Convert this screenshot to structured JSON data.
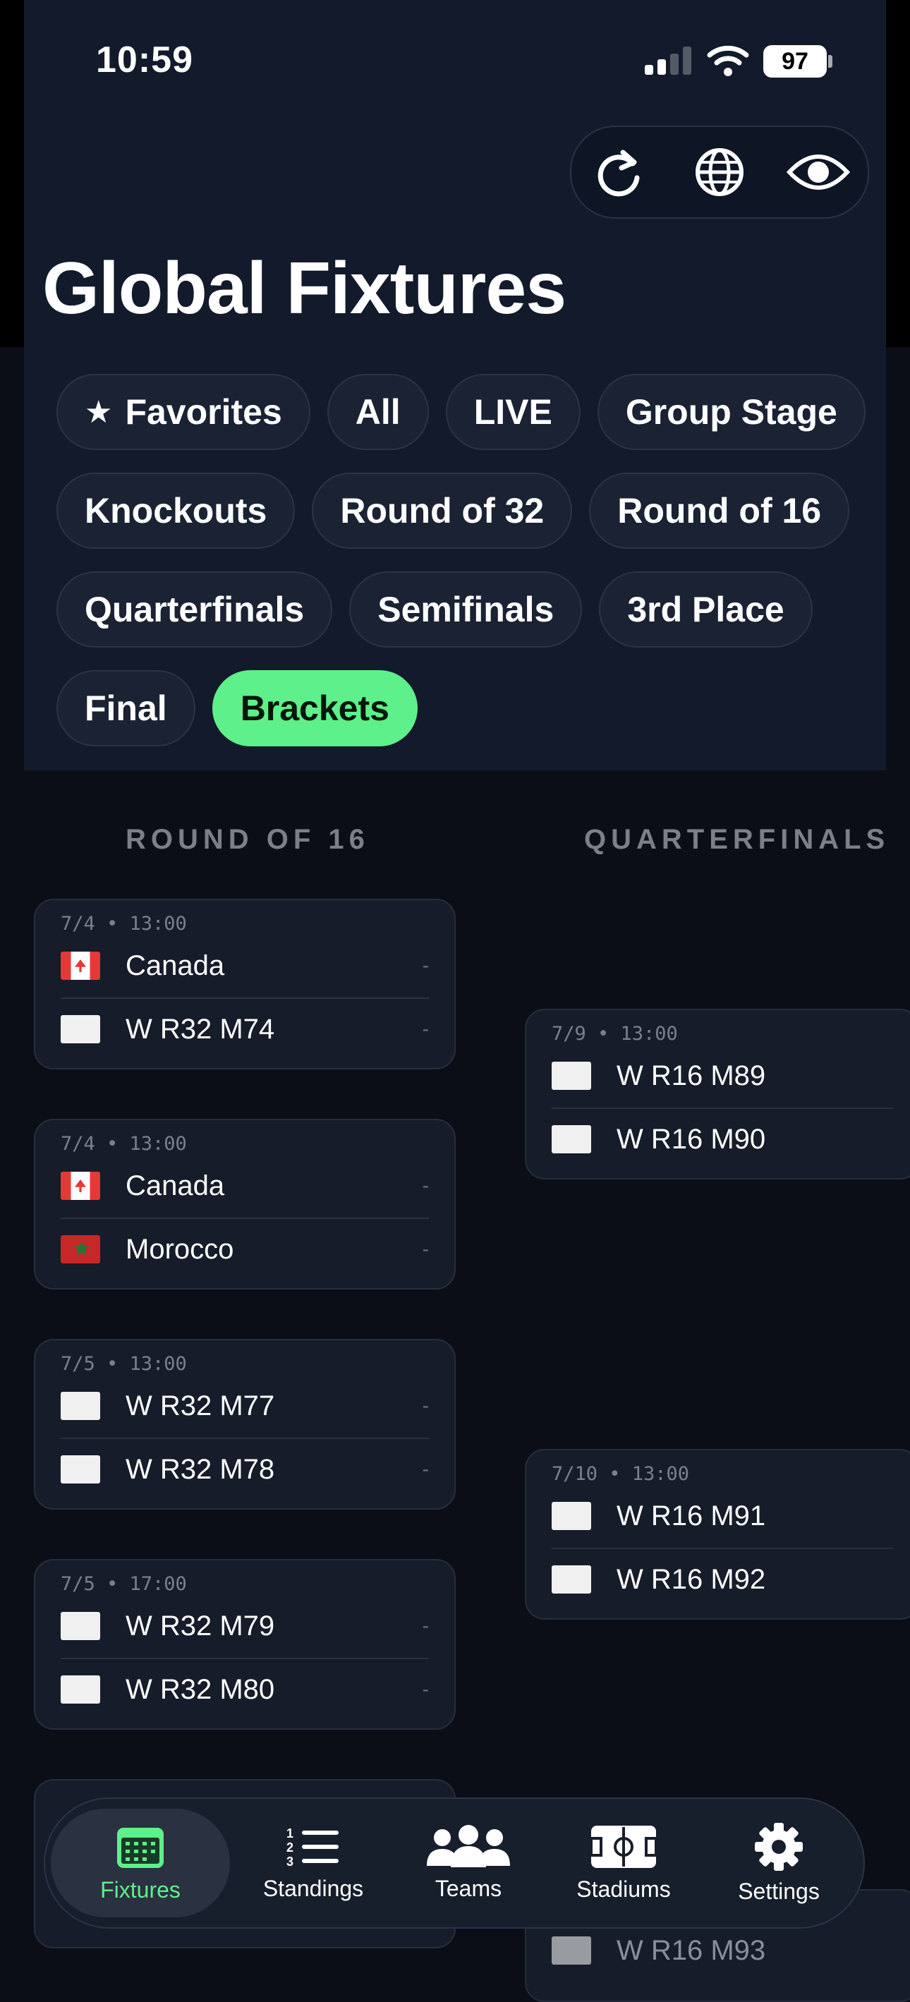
{
  "status": {
    "time": "10:59",
    "battery": "97"
  },
  "title": "Global Fixtures",
  "toolbar": {
    "refresh_icon": "refresh-icon",
    "globe_icon": "globe-icon",
    "eye_icon": "eye-icon"
  },
  "filters": {
    "favorites": "Favorites",
    "all": "All",
    "live": "LIVE",
    "group_stage": "Group Stage",
    "knockouts": "Knockouts",
    "round32": "Round of 32",
    "round16": "Round of 16",
    "quarterfinals": "Quarterfinals",
    "semifinals": "Semifinals",
    "third": "3rd Place",
    "final": "Final",
    "brackets": "Brackets"
  },
  "columns": {
    "r16": "ROUND OF 16",
    "qf": "QUARTERFINALS"
  },
  "round_of_16": [
    {
      "date": "7/4 • 13:00",
      "team1": "Canada",
      "flag1": "canada",
      "score1": "-",
      "team2": "W R32 M74",
      "flag2": "white",
      "score2": "-"
    },
    {
      "date": "7/4 • 13:00",
      "team1": "Canada",
      "flag1": "canada",
      "score1": "-",
      "team2": "Morocco",
      "flag2": "morocco",
      "score2": "-"
    },
    {
      "date": "7/5 • 13:00",
      "team1": "W R32 M77",
      "flag1": "white",
      "score1": "-",
      "team2": "W R32 M78",
      "flag2": "white",
      "score2": "-"
    },
    {
      "date": "7/5 • 17:00",
      "team1": "W R32 M79",
      "flag1": "white",
      "score1": "-",
      "team2": "W R32 M80",
      "flag2": "white",
      "score2": "-"
    }
  ],
  "quarterfinals": [
    {
      "date": "7/9 • 13:00",
      "team1": "W R16 M89",
      "flag1": "white",
      "team2": "W R16 M90",
      "flag2": "white"
    },
    {
      "date": "7/10 • 13:00",
      "team1": "W R16 M91",
      "flag1": "white",
      "team2": "W R16 M92",
      "flag2": "white"
    }
  ],
  "partial": {
    "qf_bottom_team": "W R16 M93"
  },
  "tabs": {
    "fixtures": "Fixtures",
    "standings": "Standings",
    "teams": "Teams",
    "stadiums": "Stadiums",
    "settings": "Settings"
  },
  "colors": {
    "accent": "#5ef08a",
    "background": "#0b0e16",
    "header": "#121a2b"
  }
}
